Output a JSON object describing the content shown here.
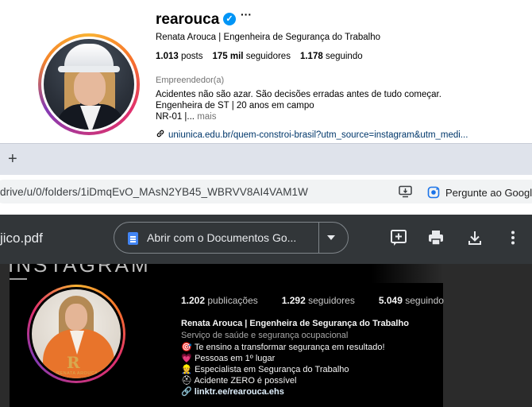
{
  "instagram_profile": {
    "username": "rearouca",
    "verified_mark": "✓",
    "more_glyph": "···",
    "full_name": "Renata Arouca | Engenheira de Segurança do Trabalho",
    "stats": {
      "posts_value": "1.013",
      "posts_label": "posts",
      "followers_value": "175 mil",
      "followers_label": "seguidores",
      "following_value": "1.178",
      "following_label": "seguindo"
    },
    "category": "Empreendedor(a)",
    "bio_lines": [
      "Acidentes não são azar. São decisões erradas antes de tudo começar.",
      "Engenheira de ST | 20 anos em campo",
      "NR-01 |..."
    ],
    "bio_more": "mais",
    "link": "uniunica.edu.br/quem-constroi-brasil?utm_source=instagram&utm_medi..."
  },
  "browser": {
    "new_tab_glyph": "+",
    "url": "drive/u/0/folders/1iDmqEvO_MAsN2YB45_WBRVV8AI4VAM1W",
    "gemini_label": "Pergunte ao Googl"
  },
  "pdf_viewer": {
    "filename": "jico.pdf",
    "open_with_label": "Abrir com o Documentos Go..."
  },
  "pdf_content": {
    "wordmark": "INSTAGRAM",
    "stats": {
      "posts_value": "1.202",
      "posts_label": "publicações",
      "followers_value": "1.292",
      "followers_label": "seguidores",
      "following_value": "5.049",
      "following_label": "seguindo"
    },
    "name": "Renata Arouca | Engenheira de Segurança do Trabalho",
    "category": "Serviço de saúde e segurança ocupacional",
    "bio": [
      {
        "emoji": "🎯",
        "text": "Te ensino a transformar segurança em resultado!"
      },
      {
        "emoji": "💗",
        "text": "Pessoas em 1º lugar"
      },
      {
        "emoji": "👷",
        "text": "Especialista em Segurança do Trabalho"
      },
      {
        "emoji": "⛑",
        "text": "Acidente ZERO é possível"
      }
    ],
    "link_glyph": "🔗",
    "link": "linktr.ee/rearouca.ehs",
    "avatar_logo": "R",
    "avatar_logo_text": "RENATA AROUCA"
  },
  "colors": {
    "instagram_link": "#00376b",
    "verified": "#0095f6",
    "pdf_toolbar": "#323639",
    "doc_icon": "#4285f4"
  }
}
